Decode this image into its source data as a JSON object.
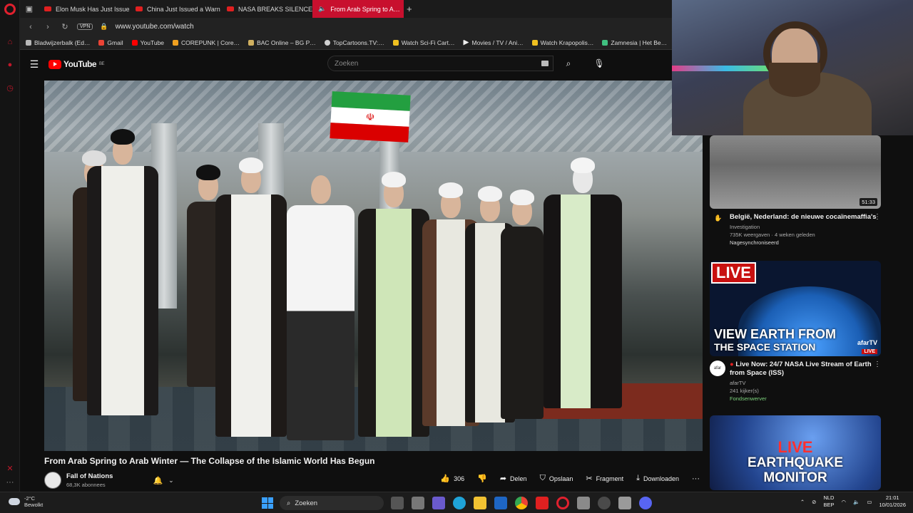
{
  "tabs": [
    {
      "label": "Elon Musk Has Just Issue…",
      "active": false
    },
    {
      "label": "China Just Issued a Warn…",
      "active": false
    },
    {
      "label": "NASA BREAKS SILENCE o…",
      "active": false
    },
    {
      "label": "From Arab Spring to A…",
      "active": true
    }
  ],
  "address": {
    "vpn": "VPN",
    "url": "www.youtube.com/watch"
  },
  "bookmarks": [
    {
      "label": "Bladwijzerbalk (Ed…",
      "color": "#b8b8b8"
    },
    {
      "label": "Gmail",
      "color": "#ea4335"
    },
    {
      "label": "YouTube",
      "color": "#ff0000"
    },
    {
      "label": "COREPUNK | Core…",
      "color": "#f0a020"
    },
    {
      "label": "BAC Online – BG P…",
      "color": "#d0b060"
    },
    {
      "label": "TopCartoons.TV:…",
      "color": "#d0d0d0"
    },
    {
      "label": "Watch Sci-Fi Cart…",
      "color": "#f0c020"
    },
    {
      "label": "Movies / TV / Ani…",
      "color": "#eeeeee"
    },
    {
      "label": "Watch Krapopolis…",
      "color": "#f0c020"
    },
    {
      "label": "Zamnesia | Het Be…",
      "color": "#40c080"
    }
  ],
  "youtube": {
    "logo": "YouTube",
    "region": "BE",
    "search_placeholder": "Zoeken"
  },
  "video": {
    "title": "From Arab Spring to Arab Winter — The Collapse of the Islamic World Has Begun",
    "channel": "Fall of Nations",
    "subscribers": "68,3K abonnees",
    "likes": "306",
    "share": "Delen",
    "save": "Opslaan",
    "clip": "Fragment",
    "download": "Downloaden"
  },
  "recommendations": [
    {
      "title": "België, Nederland: de nieuwe cocaïnemaffia's",
      "channel": "Investigation",
      "meta": "735K weergaven · 4 weken geleden",
      "badge": "Nagesynchroniseerd",
      "duration": "51:33"
    },
    {
      "title": "Live Now: 24/7 NASA Live Stream of Earth from Space (ISS)",
      "channel": "afarTV",
      "meta": "241 kijker(s)",
      "badge": "Fondsenwerver",
      "thumb_live": "LIVE",
      "thumb_line1": "VIEW EARTH FROM",
      "thumb_line2": "THE SPACE STATION",
      "thumb_brand": "afarTV",
      "thumb_live_small": "LIVE"
    },
    {
      "thumb_live": "LIVE",
      "thumb_line1": "EARTHQUAKE",
      "thumb_line2": "MONITOR"
    }
  ],
  "taskbar": {
    "temperature": "-2°C",
    "weather": "Bewolkt",
    "search": "Zoeken",
    "lang1": "NLD",
    "lang2": "BEP",
    "time": "21:01",
    "date": "10/01/2026"
  }
}
